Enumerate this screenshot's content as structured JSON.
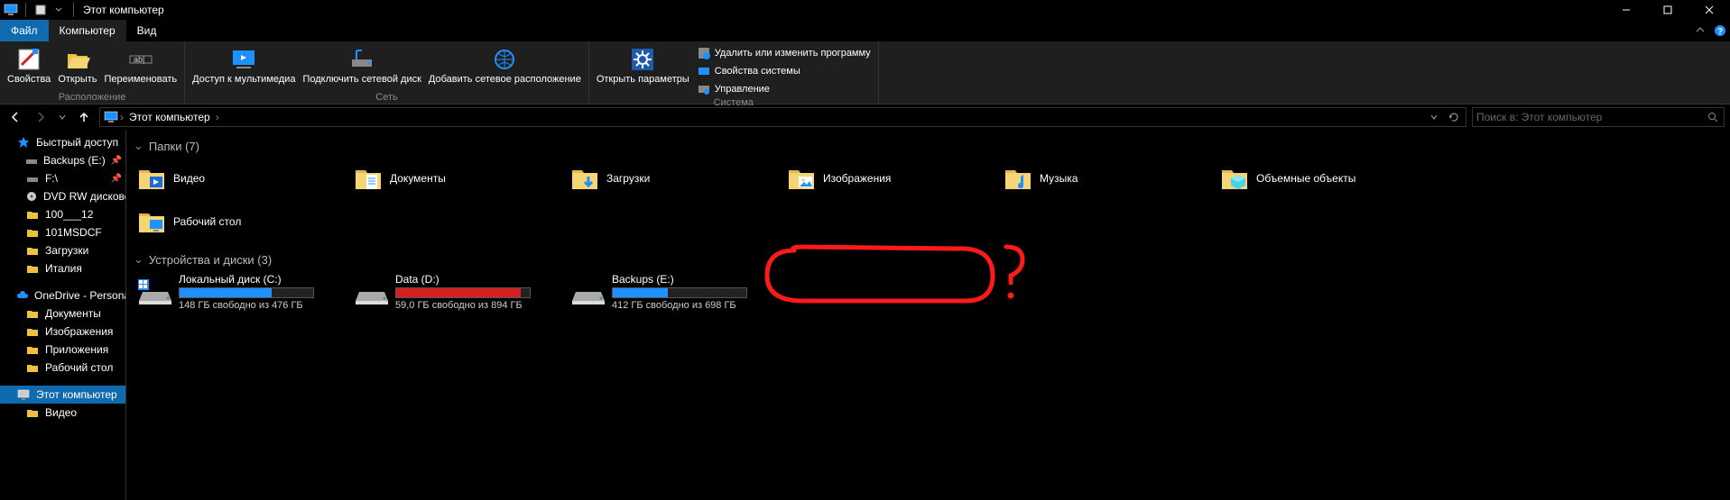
{
  "window": {
    "title": "Этот компьютер"
  },
  "tabs": {
    "file": "Файл",
    "computer": "Компьютер",
    "view": "Вид"
  },
  "ribbon": {
    "location": {
      "label": "Расположение",
      "properties": "Свойства",
      "open": "Открыть",
      "rename": "Переименовать"
    },
    "network": {
      "label": "Сеть",
      "media": "Доступ к мультимедиа",
      "mapDrive": "Подключить сетевой диск",
      "addLocation": "Добавить сетевое расположение"
    },
    "system": {
      "label": "Система",
      "openSettings": "Открыть параметры",
      "uninstall": "Удалить или изменить программу",
      "sysProps": "Свойства системы",
      "manage": "Управление"
    }
  },
  "breadcrumb": {
    "root": "Этот компьютер"
  },
  "search": {
    "placeholder": "Поиск в: Этот компьютер"
  },
  "sidebar": {
    "quickAccess": "Быстрый доступ",
    "items": [
      {
        "icon": "drive",
        "label": "Backups (E:)",
        "pinned": true
      },
      {
        "icon": "drive",
        "label": "F:\\",
        "pinned": true
      },
      {
        "icon": "disc",
        "label": "DVD RW дисковод",
        "pinned": true
      },
      {
        "icon": "folder",
        "label": "100___12"
      },
      {
        "icon": "folder",
        "label": "101MSDCF"
      },
      {
        "icon": "folder",
        "label": "Загрузки"
      },
      {
        "icon": "folder",
        "label": "Италия"
      }
    ],
    "onedrive": "OneDrive - Personal",
    "onedriveItems": [
      {
        "label": "Документы"
      },
      {
        "label": "Изображения"
      },
      {
        "label": "Приложения"
      },
      {
        "label": "Рабочий стол"
      }
    ],
    "thisPC": "Этот компьютер",
    "videos": "Видео"
  },
  "sections": {
    "folders": "Папки (7)",
    "drives": "Устройства и диски (3)"
  },
  "folders": [
    {
      "label": "Видео",
      "overlay": "video"
    },
    {
      "label": "Документы",
      "overlay": "doc"
    },
    {
      "label": "Загрузки",
      "overlay": "download"
    },
    {
      "label": "Изображения",
      "overlay": "image"
    },
    {
      "label": "Музыка",
      "overlay": "music"
    },
    {
      "label": "Объемные объекты",
      "overlay": "cube"
    },
    {
      "label": "Рабочий стол",
      "overlay": "desktop"
    }
  ],
  "drives": [
    {
      "name": "Локальный диск (C:)",
      "free": "148 ГБ свободно из 476 ГБ",
      "used_pct": 69,
      "color": "#1e90ff",
      "icon": "c"
    },
    {
      "name": "Data (D:)",
      "free": "59,0 ГБ свободно из 894 ГБ",
      "used_pct": 93,
      "color": "#d42020",
      "icon": "hdd"
    },
    {
      "name": "Backups (E:)",
      "free": "412 ГБ свободно из 698 ГБ",
      "used_pct": 41,
      "color": "#1e90ff",
      "icon": "hdd"
    }
  ],
  "annotation": {
    "mark": "?"
  }
}
